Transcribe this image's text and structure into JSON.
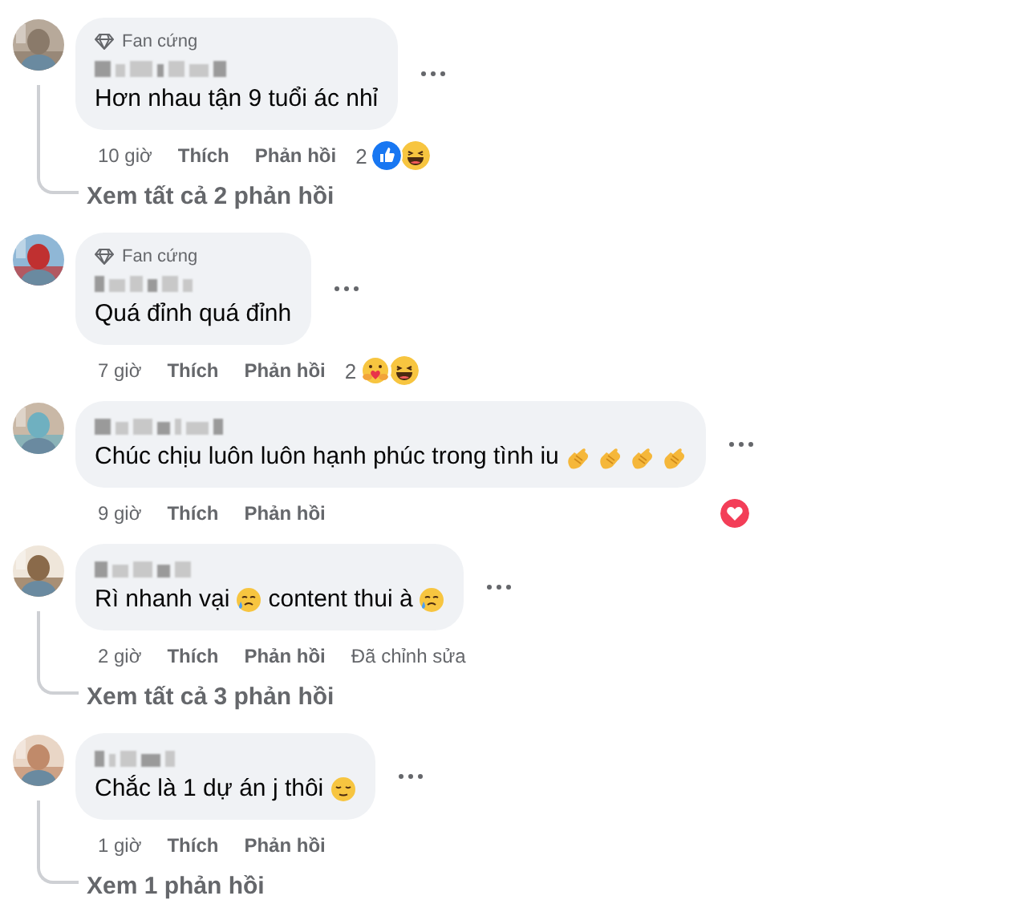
{
  "comments": [
    {
      "badge": "Fan cứng",
      "body": [
        {
          "kind": "text",
          "text": "Hơn nhau tận 9 tuổi ác nhỉ"
        }
      ],
      "time": "10 giờ",
      "like": "Thích",
      "reply": "Phản hồi",
      "reaction_count": "2",
      "reactions": [
        {
          "kind": "like"
        },
        {
          "kind": "haha"
        }
      ],
      "replies_link": "Xem tất cả 2 phản hồi"
    },
    {
      "badge": "Fan cứng",
      "body": [
        {
          "kind": "text",
          "text": "Quá đỉnh quá đỉnh"
        }
      ],
      "time": "7 giờ",
      "like": "Thích",
      "reply": "Phản hồi",
      "reaction_count": "2",
      "reactions": [
        {
          "kind": "care"
        },
        {
          "kind": "haha"
        }
      ]
    },
    {
      "body": [
        {
          "kind": "text",
          "text": "Chúc chịu luôn luôn hạnh phúc trong tình iu"
        },
        {
          "kind": "finger-heart"
        },
        {
          "kind": "finger-heart"
        },
        {
          "kind": "finger-heart"
        },
        {
          "kind": "finger-heart"
        }
      ],
      "time": "9 giờ",
      "like": "Thích",
      "reply": "Phản hồi",
      "reactions": [
        {
          "kind": "love"
        }
      ]
    },
    {
      "body": [
        {
          "kind": "text",
          "text": "Rì nhanh vại"
        },
        {
          "kind": "sad-smile"
        },
        {
          "kind": "text",
          "text": "content thui à"
        },
        {
          "kind": "sad-smile"
        }
      ],
      "time": "2 giờ",
      "like": "Thích",
      "reply": "Phản hồi",
      "edited": "Đã chỉnh sửa",
      "replies_link": "Xem tất cả 3 phản hồi"
    },
    {
      "body": [
        {
          "kind": "text",
          "text": "Chắc là 1 dự án j thôi"
        },
        {
          "kind": "relieved"
        }
      ],
      "time": "1 giờ",
      "like": "Thích",
      "reply": "Phản hồi",
      "replies_link": "Xem 1 phản hồi"
    }
  ]
}
